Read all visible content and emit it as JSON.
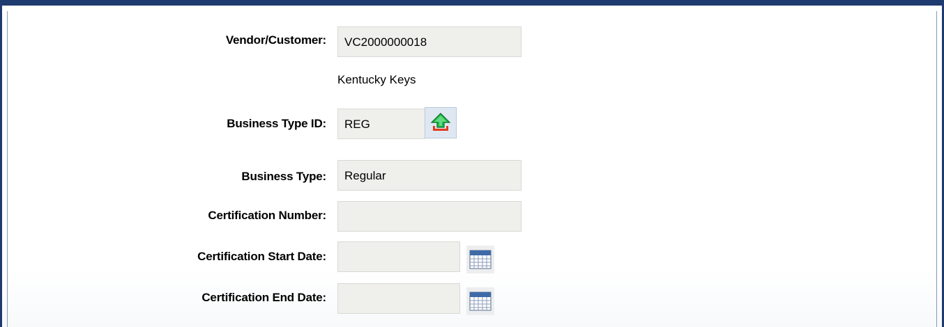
{
  "form": {
    "vendor_label": "Vendor/Customer:",
    "vendor_value": "VC2000000018",
    "vendor_name": "Kentucky Keys",
    "business_type_id_label": "Business Type ID:",
    "business_type_id_value": "REG",
    "business_type_label": "Business Type:",
    "business_type_value": "Regular",
    "cert_number_label": "Certification Number:",
    "cert_number_value": "",
    "cert_start_label": "Certification Start Date:",
    "cert_start_value": "",
    "cert_end_label": "Certification End Date:",
    "cert_end_value": ""
  },
  "icons": {
    "lookup": "upload-arrow-icon",
    "calendar": "calendar-icon"
  }
}
